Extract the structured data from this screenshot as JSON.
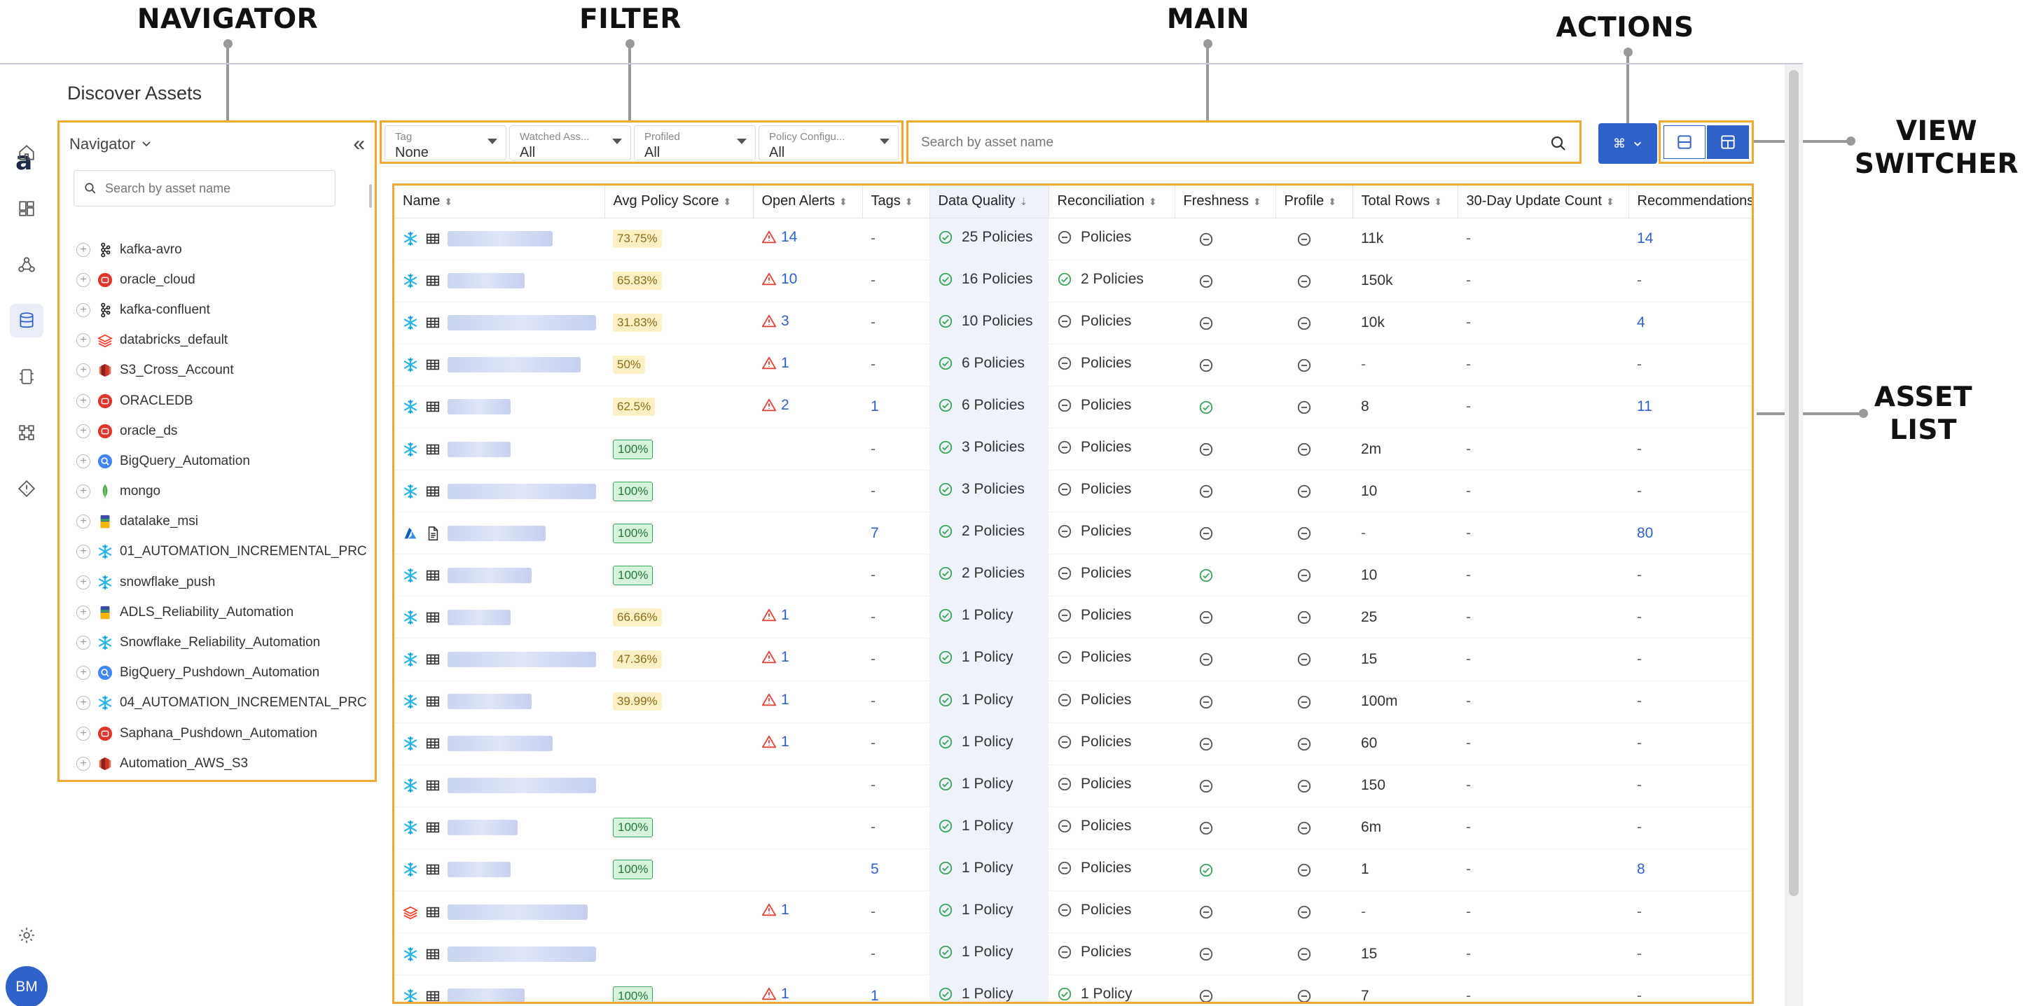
{
  "callouts": {
    "navigator": "NAVIGATOR",
    "filter": "FILTER",
    "main": "MAIN",
    "actions": "ACTIONS",
    "view_switcher_line1": "VIEW",
    "view_switcher_line2": "SWITCHER",
    "asset_list_line1": "ASSET",
    "asset_list_line2": "LIST"
  },
  "app": {
    "logo": "a",
    "page_title": "Discover Assets",
    "avatar_initials": "BM",
    "rail_icons": [
      "home-icon",
      "dashboard-icon",
      "pipeline-icon",
      "database-icon",
      "compute-icon",
      "network-icon",
      "alert-icon",
      "settings-icon"
    ]
  },
  "navigator": {
    "title": "Navigator",
    "collapse_glyph": "«",
    "search_placeholder": "Search by asset name",
    "items": [
      {
        "label": "kafka-avro",
        "icon": "kafka-icon"
      },
      {
        "label": "oracle_cloud",
        "icon": "oracle-icon"
      },
      {
        "label": "kafka-confluent",
        "icon": "kafka-icon"
      },
      {
        "label": "databricks_default",
        "icon": "databricks-icon"
      },
      {
        "label": "S3_Cross_Account",
        "icon": "s3-icon"
      },
      {
        "label": "ORACLEDB",
        "icon": "oracle-icon"
      },
      {
        "label": "oracle_ds",
        "icon": "oracle-icon"
      },
      {
        "label": "BigQuery_Automation",
        "icon": "bigquery-icon"
      },
      {
        "label": "mongo",
        "icon": "mongo-icon"
      },
      {
        "label": "datalake_msi",
        "icon": "datalake-icon"
      },
      {
        "label": "01_AUTOMATION_INCREMENTAL_PRC",
        "icon": "snowflake-icon"
      },
      {
        "label": "snowflake_push",
        "icon": "snowflake-icon"
      },
      {
        "label": "ADLS_Reliability_Automation",
        "icon": "datalake-icon"
      },
      {
        "label": "Snowflake_Reliability_Automation",
        "icon": "snowflake-icon"
      },
      {
        "label": "BigQuery_Pushdown_Automation",
        "icon": "bigquery-icon"
      },
      {
        "label": "04_AUTOMATION_INCREMENTAL_PRC",
        "icon": "snowflake-icon"
      },
      {
        "label": "Saphana_Pushdown_Automation",
        "icon": "oracle-icon"
      },
      {
        "label": "Automation_AWS_S3",
        "icon": "s3-icon"
      }
    ]
  },
  "filters": [
    {
      "label": "Tag",
      "value": "None"
    },
    {
      "label": "Watched Ass...",
      "value": "All"
    },
    {
      "label": "Profiled",
      "value": "All"
    },
    {
      "label": "Policy Configu...",
      "value": "All"
    }
  ],
  "search": {
    "placeholder": "Search by asset name"
  },
  "actions": {
    "glyph": "⌘"
  },
  "table": {
    "columns": [
      "Name",
      "Avg Policy Score",
      "Open Alerts",
      "Tags",
      "Data Quality",
      "Reconciliation",
      "Freshness",
      "Profile",
      "Total Rows",
      "30-Day Update Count",
      "Recommendations"
    ],
    "rows": [
      {
        "src": "snowflake",
        "type": "table",
        "blur": 150,
        "score": "73.75%",
        "score_style": "yellow",
        "alerts": "14",
        "tags": "-",
        "dq": "25 Policies",
        "recon_ok": false,
        "recon": "Policies",
        "fresh_ok": false,
        "rows": "11k",
        "updates": "-",
        "recs": "14"
      },
      {
        "src": "snowflake",
        "type": "table",
        "blur": 110,
        "score": "65.83%",
        "score_style": "yellow",
        "alerts": "10",
        "tags": "-",
        "dq": "16 Policies",
        "recon_ok": true,
        "recon": "2 Policies",
        "fresh_ok": false,
        "rows": "150k",
        "updates": "-",
        "recs": "-"
      },
      {
        "src": "snowflake",
        "type": "table",
        "blur": 220,
        "score": "31.83%",
        "score_style": "yellow",
        "alerts": "3",
        "tags": "-",
        "dq": "10 Policies",
        "recon_ok": false,
        "recon": "Policies",
        "fresh_ok": false,
        "rows": "10k",
        "updates": "-",
        "recs": "4"
      },
      {
        "src": "snowflake",
        "type": "table",
        "blur": 190,
        "score": "50%",
        "score_style": "yellow",
        "alerts": "1",
        "tags": "-",
        "dq": "6 Policies",
        "recon_ok": false,
        "recon": "Policies",
        "fresh_ok": false,
        "rows": "-",
        "updates": "-",
        "recs": "-"
      },
      {
        "src": "snowflake",
        "type": "table",
        "blur": 90,
        "score": "62.5%",
        "score_style": "yellow",
        "alerts": "2",
        "tags": "1",
        "dq": "6 Policies",
        "recon_ok": false,
        "recon": "Policies",
        "fresh_ok": true,
        "rows": "8",
        "updates": "-",
        "recs": "11"
      },
      {
        "src": "snowflake",
        "type": "table",
        "blur": 90,
        "score": "100%",
        "score_style": "green",
        "alerts": "",
        "tags": "-",
        "dq": "3 Policies",
        "recon_ok": false,
        "recon": "Policies",
        "fresh_ok": false,
        "rows": "2m",
        "updates": "-",
        "recs": "-"
      },
      {
        "src": "snowflake",
        "type": "table",
        "blur": 220,
        "score": "100%",
        "score_style": "green",
        "alerts": "",
        "tags": "-",
        "dq": "3 Policies",
        "recon_ok": false,
        "recon": "Policies",
        "fresh_ok": false,
        "rows": "10",
        "updates": "-",
        "recs": "-"
      },
      {
        "src": "azure",
        "type": "file",
        "blur": 140,
        "score": "100%",
        "score_style": "green",
        "alerts": "",
        "tags": "7",
        "dq": "2 Policies",
        "recon_ok": false,
        "recon": "Policies",
        "fresh_ok": false,
        "rows": "-",
        "updates": "-",
        "recs": "80"
      },
      {
        "src": "snowflake",
        "type": "table",
        "blur": 120,
        "score": "100%",
        "score_style": "green",
        "alerts": "",
        "tags": "-",
        "dq": "2 Policies",
        "recon_ok": false,
        "recon": "Policies",
        "fresh_ok": true,
        "rows": "10",
        "updates": "-",
        "recs": "-"
      },
      {
        "src": "snowflake",
        "type": "table",
        "blur": 90,
        "score": "66.66%",
        "score_style": "yellow",
        "alerts": "1",
        "tags": "-",
        "dq": "1 Policy",
        "recon_ok": false,
        "recon": "Policies",
        "fresh_ok": false,
        "rows": "25",
        "updates": "-",
        "recs": "-"
      },
      {
        "src": "snowflake",
        "type": "table",
        "blur": 220,
        "score": "47.36%",
        "score_style": "yellow",
        "alerts": "1",
        "tags": "-",
        "dq": "1 Policy",
        "recon_ok": false,
        "recon": "Policies",
        "fresh_ok": false,
        "rows": "15",
        "updates": "-",
        "recs": "-"
      },
      {
        "src": "snowflake",
        "type": "table",
        "blur": 120,
        "score": "39.99%",
        "score_style": "yellow",
        "alerts": "1",
        "tags": "-",
        "dq": "1 Policy",
        "recon_ok": false,
        "recon": "Policies",
        "fresh_ok": false,
        "rows": "100m",
        "updates": "-",
        "recs": "-"
      },
      {
        "src": "snowflake",
        "type": "table",
        "blur": 150,
        "score": "",
        "score_style": "",
        "alerts": "1",
        "tags": "-",
        "dq": "1 Policy",
        "recon_ok": false,
        "recon": "Policies",
        "fresh_ok": false,
        "rows": "60",
        "updates": "-",
        "recs": "-"
      },
      {
        "src": "snowflake",
        "type": "table",
        "blur": 225,
        "score": "",
        "score_style": "",
        "alerts": "",
        "tags": "-",
        "dq": "1 Policy",
        "recon_ok": false,
        "recon": "Policies",
        "fresh_ok": false,
        "rows": "150",
        "updates": "-",
        "recs": "-"
      },
      {
        "src": "snowflake",
        "type": "table",
        "blur": 100,
        "score": "100%",
        "score_style": "green",
        "alerts": "",
        "tags": "-",
        "dq": "1 Policy",
        "recon_ok": false,
        "recon": "Policies",
        "fresh_ok": false,
        "rows": "6m",
        "updates": "-",
        "recs": "-"
      },
      {
        "src": "snowflake",
        "type": "table",
        "blur": 90,
        "score": "100%",
        "score_style": "green",
        "alerts": "",
        "tags": "5",
        "dq": "1 Policy",
        "recon_ok": false,
        "recon": "Policies",
        "fresh_ok": true,
        "rows": "1",
        "updates": "-",
        "recs": "8"
      },
      {
        "src": "databricks",
        "type": "table",
        "blur": 200,
        "score": "",
        "score_style": "",
        "alerts": "1",
        "tags": "-",
        "dq": "1 Policy",
        "recon_ok": false,
        "recon": "Policies",
        "fresh_ok": false,
        "rows": "-",
        "updates": "-",
        "recs": "-"
      },
      {
        "src": "snowflake",
        "type": "table",
        "blur": 220,
        "score": "",
        "score_style": "",
        "alerts": "",
        "tags": "-",
        "dq": "1 Policy",
        "recon_ok": false,
        "recon": "Policies",
        "fresh_ok": false,
        "rows": "15",
        "updates": "-",
        "recs": "-"
      },
      {
        "src": "snowflake",
        "type": "table",
        "blur": 110,
        "score": "100%",
        "score_style": "green",
        "alerts": "1",
        "tags": "1",
        "dq": "1 Policy",
        "recon_ok": true,
        "recon": "1 Policy",
        "fresh_ok": false,
        "rows": "7",
        "updates": "-",
        "recs": "-"
      }
    ]
  },
  "colors": {
    "accent": "#2f62c9",
    "callout_border": "#f0a830",
    "ok_green": "#39a65a",
    "alert_red": "#e0453a",
    "neutral_icon": "#555555"
  }
}
